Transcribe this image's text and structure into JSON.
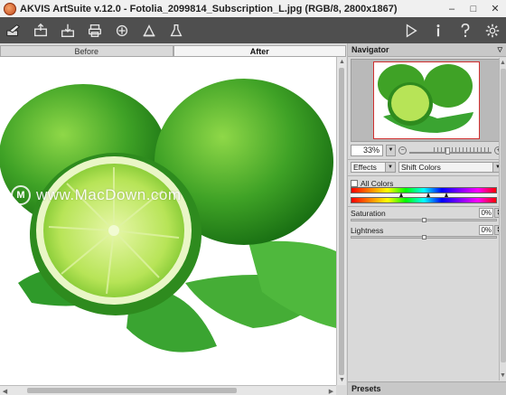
{
  "window": {
    "title": "AKVIS ArtSuite v.12.0 - Fotolia_2099814_Subscription_L.jpg (RGB/8, 2800x1867)",
    "controls": [
      "–",
      "□",
      "✕"
    ]
  },
  "toolbar": {
    "left_icons": [
      "brush-icon",
      "open-icon",
      "save-icon",
      "print-icon",
      "share-icon",
      "batch-icon",
      "settings-flask-icon"
    ],
    "right_icons": [
      "run-icon",
      "info-icon",
      "help-icon",
      "preferences-icon"
    ]
  },
  "view_tabs": [
    {
      "label": "Before",
      "active": false
    },
    {
      "label": "After",
      "active": true
    }
  ],
  "watermark": {
    "logo": "M",
    "text": "www.MacDown.com"
  },
  "navigator": {
    "title": "Navigator",
    "zoom": "33%",
    "zoom_level": 0.33
  },
  "effects": {
    "category": "Effects",
    "selected": "Shift Colors"
  },
  "all_colors": {
    "label": "All Colors",
    "checked": false
  },
  "params": [
    {
      "label": "Saturation",
      "value": "0%",
      "level": 0.5
    },
    {
      "label": "Lightness",
      "value": "0%",
      "level": 0.5
    }
  ],
  "presets": {
    "title": "Presets"
  },
  "colors": {
    "toolbar_bg": "#4f4f4f",
    "panel_bg": "#d9d9d9",
    "lime_dark": "#2e8b1e",
    "lime_light": "#a6e04a"
  }
}
